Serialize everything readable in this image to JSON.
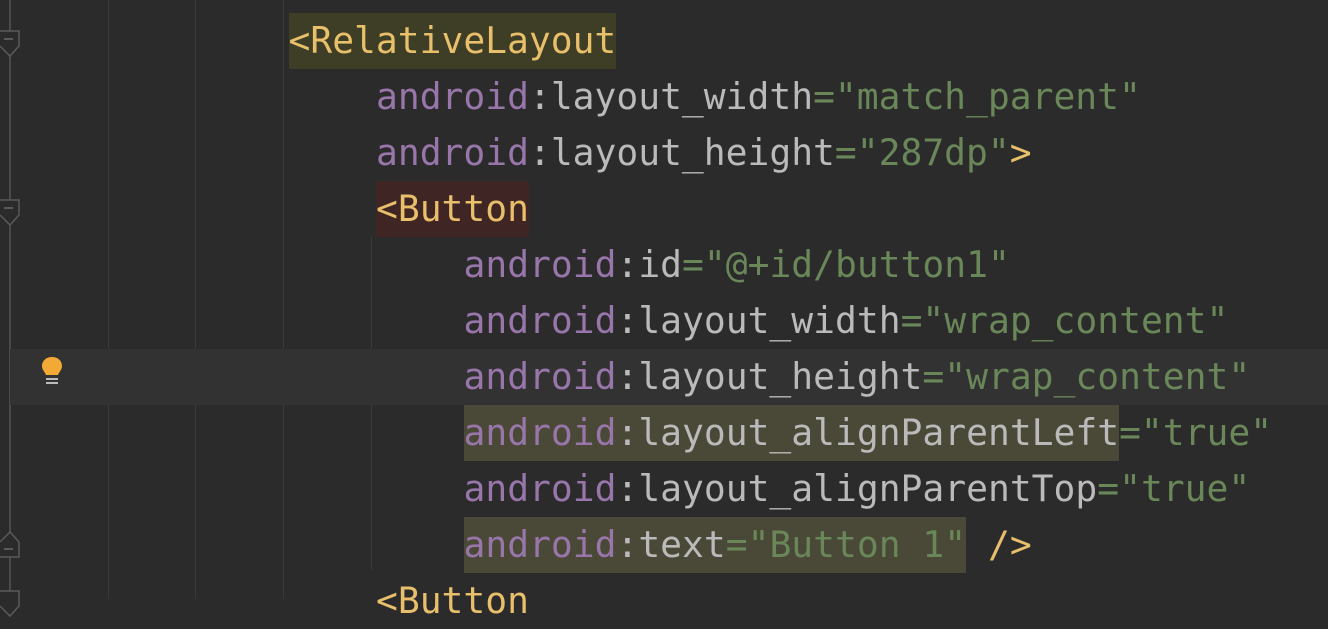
{
  "colors": {
    "background": "#2b2b2b",
    "current_line": "#323232",
    "tag": "#e8bf6a",
    "namespace": "#9876aa",
    "attribute": "#bababa",
    "value": "#6a8759",
    "tag_match_highlight": "#3e3d25",
    "tag_error_highlight": "#402525",
    "usage_highlight": "#4a4836",
    "bulb": "#f2a935"
  },
  "editor": {
    "current_line_index": 6,
    "lightbulb_icon": "intention-bulb",
    "lines": [
      {
        "indent": 12,
        "segments": [
          {
            "t": "<RelativeLayout",
            "c": "tag",
            "hl": "tag_match_highlight"
          }
        ]
      },
      {
        "indent": 16,
        "segments": [
          {
            "t": "android",
            "c": "namespace"
          },
          {
            "t": ":layout_width",
            "c": "attribute"
          },
          {
            "t": "=\"match_parent\"",
            "c": "value"
          }
        ]
      },
      {
        "indent": 16,
        "segments": [
          {
            "t": "android",
            "c": "namespace"
          },
          {
            "t": ":layout_height",
            "c": "attribute"
          },
          {
            "t": "=\"287dp\"",
            "c": "value"
          },
          {
            "t": ">",
            "c": "tag"
          }
        ]
      },
      {
        "indent": 16,
        "segments": [
          {
            "t": "<Button",
            "c": "tag",
            "hl": "tag_error_highlight"
          }
        ]
      },
      {
        "indent": 20,
        "segments": [
          {
            "t": "android",
            "c": "namespace"
          },
          {
            "t": ":id",
            "c": "attribute"
          },
          {
            "t": "=\"@+id/button1\"",
            "c": "value"
          }
        ]
      },
      {
        "indent": 20,
        "segments": [
          {
            "t": "android",
            "c": "namespace"
          },
          {
            "t": ":layout_width",
            "c": "attribute"
          },
          {
            "t": "=\"wrap_content\"",
            "c": "value"
          }
        ]
      },
      {
        "indent": 20,
        "segments": [
          {
            "t": "android",
            "c": "namespace"
          },
          {
            "t": ":layout_height",
            "c": "attribute"
          },
          {
            "t": "=\"wrap_content\"",
            "c": "value"
          }
        ]
      },
      {
        "indent": 20,
        "segments": [
          {
            "t": "android",
            "c": "namespace",
            "hl": "usage_highlight"
          },
          {
            "t": ":layout_alignParentLeft",
            "c": "attribute",
            "hl": "usage_highlight"
          },
          {
            "t": "=\"true\"",
            "c": "value"
          }
        ]
      },
      {
        "indent": 20,
        "segments": [
          {
            "t": "android",
            "c": "namespace"
          },
          {
            "t": ":layout_alignParentTop",
            "c": "attribute"
          },
          {
            "t": "=\"true\"",
            "c": "value"
          }
        ]
      },
      {
        "indent": 20,
        "segments": [
          {
            "t": "android",
            "c": "namespace",
            "hl": "usage_highlight"
          },
          {
            "t": ":text",
            "c": "attribute",
            "hl": "usage_highlight"
          },
          {
            "t": "=\"Button 1\"",
            "c": "value",
            "hl": "usage_highlight"
          },
          {
            "t": " ",
            "c": "attribute"
          },
          {
            "t": "/>",
            "c": "tag"
          }
        ]
      },
      {
        "indent": 16,
        "segments": [
          {
            "t": "<Button",
            "c": "tag"
          }
        ]
      }
    ]
  }
}
